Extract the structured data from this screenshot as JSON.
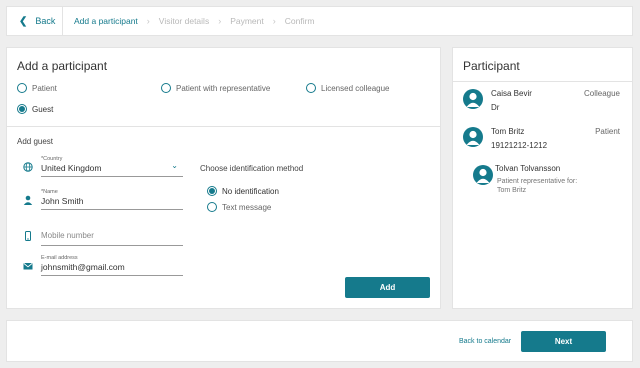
{
  "nav": {
    "back_label": "Back",
    "steps": [
      "Add a participant",
      "Visitor details",
      "Payment",
      "Confirm"
    ]
  },
  "add_participant": {
    "title": "Add a participant",
    "types": [
      "Patient",
      "Patient with representative",
      "Licensed colleague",
      "Guest"
    ],
    "selected": "Guest"
  },
  "add_guest": {
    "title": "Add guest",
    "country": {
      "label": "*Country",
      "value": "United Kingdom"
    },
    "name": {
      "label": "*Name",
      "value": "John Smith"
    },
    "mobile": {
      "placeholder": "Mobile number"
    },
    "email": {
      "label": "E-mail address",
      "value": "johnsmith@gmail.com"
    },
    "id_method": {
      "title": "Choose identification method",
      "options": [
        "No identification",
        "Text message"
      ],
      "selected": "No identification"
    },
    "add_button": "Add"
  },
  "participants": {
    "title": "Participant",
    "list": [
      {
        "name": "Caisa Bevir",
        "sub": "Dr",
        "role": "Colleague"
      },
      {
        "name": "Tom Britz",
        "sub": "19121212-1212",
        "role": "Patient"
      },
      {
        "name": "Tolvan Tolvansson",
        "note1": "Patient representative for:",
        "note2": "Tom Britz"
      }
    ]
  },
  "footer": {
    "back_to_calendar": "Back to calendar",
    "next": "Next"
  },
  "colors": {
    "accent": "#157a8c",
    "background": "#eeeeee"
  }
}
